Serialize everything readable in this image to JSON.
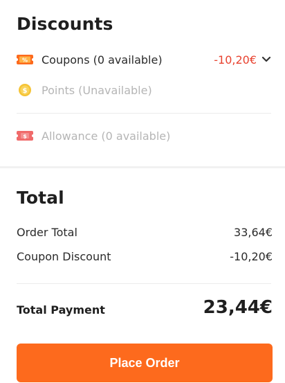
{
  "discounts": {
    "title": "Discounts",
    "coupons": {
      "label": "Coupons (0 available)",
      "amount": "-10,20€",
      "icon": "coupon-icon",
      "color": "#fd6a1d"
    },
    "points": {
      "label": "Points (Unavailable)",
      "icon": "coin-icon",
      "color": "#f5c335"
    },
    "allowance": {
      "label": "Allowance (0 available)",
      "icon": "allowance-ticket-icon",
      "color": "#ef4747"
    }
  },
  "total": {
    "title": "Total",
    "order_total_label": "Order Total",
    "order_total_value": "33,64€",
    "coupon_discount_label": "Coupon Discount",
    "coupon_discount_value": "-10,20€",
    "payment_label": "Total Payment",
    "payment_value": "23,44€"
  },
  "button": {
    "label": "Place Order",
    "color": "#fd6a1d"
  }
}
